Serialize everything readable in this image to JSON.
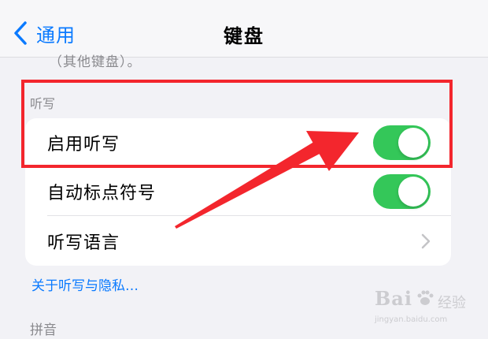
{
  "nav": {
    "back_label": "通用",
    "title": "键盘"
  },
  "previous_section_footer": "（其他键盘）。",
  "dictation_section": {
    "header": "听写",
    "rows": [
      {
        "label": "启用听写",
        "control": "toggle",
        "on": true
      },
      {
        "label": "自动标点符号",
        "control": "toggle",
        "on": true
      },
      {
        "label": "听写语言",
        "control": "chevron"
      }
    ],
    "footer_link": "关于听写与隐私…"
  },
  "pinyin_section": {
    "header": "拼音"
  },
  "watermark": {
    "logo_left": "Bai",
    "logo_right": "经验",
    "url": "jingyan.baidu.com"
  },
  "colors": {
    "accent": "#0a7aff",
    "toggle_on": "#34c759",
    "annotation_red": "#f3262d"
  },
  "icons": [
    "chevron-left-icon",
    "chevron-right-icon",
    "baidu-paw-icon"
  ]
}
